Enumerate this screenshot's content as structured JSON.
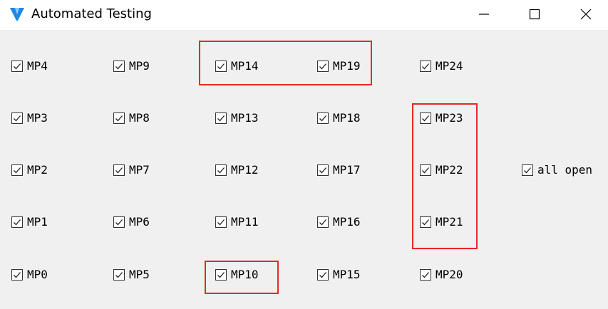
{
  "window": {
    "title": "Automated Testing",
    "app_icon": "v-logo-icon",
    "controls": [
      "minimize-icon",
      "maximize-icon",
      "close-icon"
    ]
  },
  "checkboxes": {
    "mp0": {
      "label": "MP0",
      "checked": true
    },
    "mp1": {
      "label": "MP1",
      "checked": true
    },
    "mp2": {
      "label": "MP2",
      "checked": true
    },
    "mp3": {
      "label": "MP3",
      "checked": true
    },
    "mp4": {
      "label": "MP4",
      "checked": true
    },
    "mp5": {
      "label": "MP5",
      "checked": true
    },
    "mp6": {
      "label": "MP6",
      "checked": true
    },
    "mp7": {
      "label": "MP7",
      "checked": true
    },
    "mp8": {
      "label": "MP8",
      "checked": true
    },
    "mp9": {
      "label": "MP9",
      "checked": true
    },
    "mp10": {
      "label": "MP10",
      "checked": true
    },
    "mp11": {
      "label": "MP11",
      "checked": true
    },
    "mp12": {
      "label": "MP12",
      "checked": true
    },
    "mp13": {
      "label": "MP13",
      "checked": true
    },
    "mp14": {
      "label": "MP14",
      "checked": true
    },
    "mp15": {
      "label": "MP15",
      "checked": true
    },
    "mp16": {
      "label": "MP16",
      "checked": true
    },
    "mp17": {
      "label": "MP17",
      "checked": true
    },
    "mp18": {
      "label": "MP18",
      "checked": true
    },
    "mp19": {
      "label": "MP19",
      "checked": true
    },
    "mp20": {
      "label": "MP20",
      "checked": true
    },
    "mp21": {
      "label": "MP21",
      "checked": true
    },
    "mp22": {
      "label": "MP22",
      "checked": true
    },
    "mp23": {
      "label": "MP23",
      "checked": true
    },
    "mp24": {
      "label": "MP24",
      "checked": true
    },
    "all_open": {
      "label": "all open",
      "checked": true
    }
  },
  "colors": {
    "highlight": "#e8262a",
    "background": "#f0f0f0",
    "titlebar": "#ffffff",
    "logo": "#1e88e5"
  }
}
